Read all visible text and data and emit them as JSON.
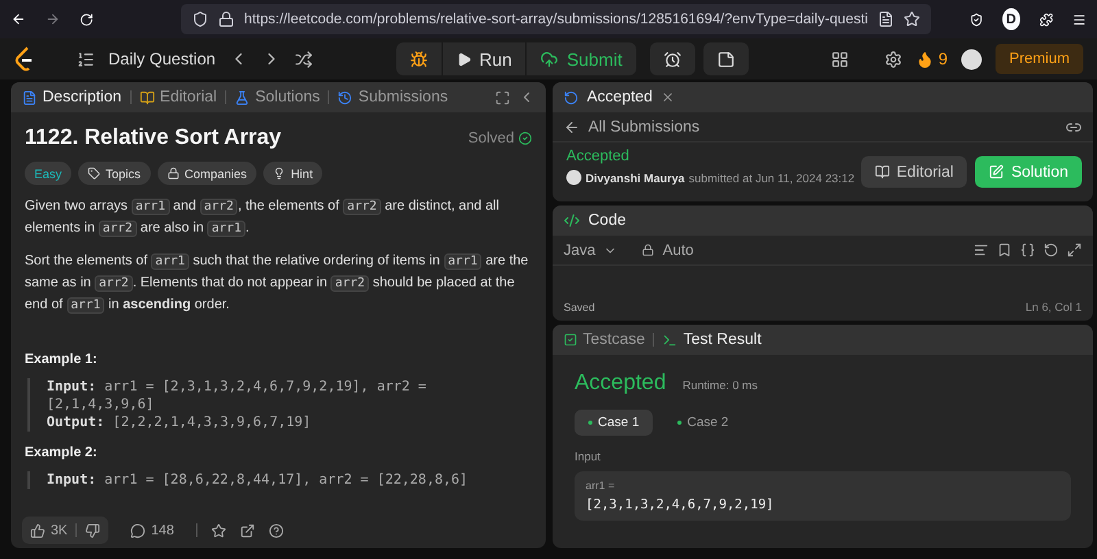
{
  "browser": {
    "url": "https://leetcode.com/problems/relative-sort-array/submissions/1285161694/?envType=daily-questi",
    "profile_initial": "D"
  },
  "header": {
    "nav_title": "Daily Question",
    "run": "Run",
    "submit": "Submit",
    "streak": "9",
    "premium": "Premium"
  },
  "description": {
    "tabs": [
      {
        "label": "Description",
        "selected": true
      },
      {
        "label": "Editorial",
        "selected": false
      },
      {
        "label": "Solutions",
        "selected": false
      },
      {
        "label": "Submissions",
        "selected": false
      }
    ],
    "title": "1122. Relative Sort Array",
    "status": "Solved",
    "tags": [
      {
        "label": "Easy",
        "kind": "difficulty"
      },
      {
        "label": "Topics",
        "kind": "topics"
      },
      {
        "label": "Companies",
        "kind": "companies"
      },
      {
        "label": "Hint",
        "kind": "hint"
      }
    ],
    "paragraphs": [
      [
        {
          "kind": "text",
          "text": "Given two arrays "
        },
        {
          "kind": "code",
          "text": "arr1"
        },
        {
          "kind": "text",
          "text": " and "
        },
        {
          "kind": "code",
          "text": "arr2"
        },
        {
          "kind": "text",
          "text": ", the elements of "
        },
        {
          "kind": "code",
          "text": "arr2"
        },
        {
          "kind": "text",
          "text": " are distinct, and all elements in "
        },
        {
          "kind": "code",
          "text": "arr2"
        },
        {
          "kind": "text",
          "text": " are also in "
        },
        {
          "kind": "code",
          "text": "arr1"
        },
        {
          "kind": "text",
          "text": "."
        }
      ],
      [
        {
          "kind": "text",
          "text": "Sort the elements of "
        },
        {
          "kind": "code",
          "text": "arr1"
        },
        {
          "kind": "text",
          "text": " such that the relative ordering of items in "
        },
        {
          "kind": "code",
          "text": "arr1"
        },
        {
          "kind": "text",
          "text": " are the same as in "
        },
        {
          "kind": "code",
          "text": "arr2"
        },
        {
          "kind": "text",
          "text": ". Elements that do not appear in "
        },
        {
          "kind": "code",
          "text": "arr2"
        },
        {
          "kind": "text",
          "text": " should be placed at the end of "
        },
        {
          "kind": "code",
          "text": "arr1"
        },
        {
          "kind": "text",
          "text": " in "
        },
        {
          "kind": "bold",
          "text": "ascending"
        },
        {
          "kind": "text",
          "text": " order."
        }
      ]
    ],
    "examples": [
      {
        "heading": "Example 1:",
        "lines": [
          "**Input:** arr1 = [2,3,1,3,2,4,6,7,9,2,19], arr2 = [2,1,4,3,9,6]",
          "**Output:** [2,2,2,1,4,3,3,9,6,7,19]"
        ]
      },
      {
        "heading": "Example 2:",
        "lines": [
          "**Input:** arr1 = [28,6,22,8,44,17], arr2 = [22,28,8,6]"
        ]
      }
    ],
    "footer": {
      "likes": "3K",
      "comments": "148"
    }
  },
  "submission": {
    "tab": "Accepted",
    "back_label": "All Submissions",
    "verdict": "Accepted",
    "user": "Divyanshi Maurya",
    "submitted": "submitted at Jun 11, 2024 23:12",
    "buttons": [
      {
        "label": "Editorial",
        "kind": "secondary"
      },
      {
        "label": "Solution",
        "kind": "primary"
      }
    ]
  },
  "code": {
    "title": "Code",
    "language": "Java",
    "mode": "Auto",
    "save_status": "Saved",
    "cursor": "Ln 6, Col 1"
  },
  "test": {
    "tabs": [
      {
        "label": "Testcase",
        "selected": false
      },
      {
        "label": "Test Result",
        "selected": true
      }
    ],
    "verdict": "Accepted",
    "runtime": "Runtime: 0 ms",
    "cases": [
      {
        "label": "Case 1",
        "selected": true
      },
      {
        "label": "Case 2",
        "selected": false
      }
    ],
    "input_label": "Input",
    "inputs": [
      {
        "name": "arr1 =",
        "value": "[2,3,1,3,2,4,6,7,9,2,19]"
      }
    ]
  }
}
